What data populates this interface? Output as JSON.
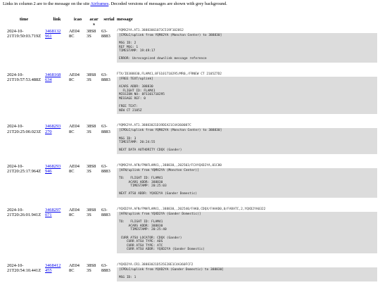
{
  "intro": {
    "before": "Links in column 2 are to the message on the site ",
    "link": "Airframes",
    "after": ". Decoded versions of messages are shown with grey background."
  },
  "columns": {
    "time": "time",
    "link": "link",
    "icao": "icao",
    "acars": "acar\ns",
    "serial": "serial",
    "message": "message"
  },
  "rows": [
    {
      "time": "2024-10-\n21T19:50:03.719Z",
      "link": "3468132\n961",
      "icao": "AE04\n8C",
      "acars": "38S8\n3S",
      "serial": "63-\n8883",
      "raw": "/YQMX2YA.AT1.38883061073C519F1020S2",
      "decoded": "[CPDLC/uplink from YQMX2YA (Moncton Center) to 388830]\n\nMSG ID: 2\nREF MSG: 1\nTIMESTAMP: 19:49:17\n\nERROR: Unrecognized downlink message reference"
    },
    {
      "time": "2024-10-\n21T19:57:53.488Z",
      "link": "3468168\n634",
      "icao": "AE04\n8C",
      "acars": "38S8\n3S",
      "serial": "63-\n8883",
      "raw": "FTX/ID388830,FLAM41,8FS101710295/MR0,/FRNEW CT 2105Z7D2",
      "decoded": "[FREE TEXT/uplink]\n\nACARS ADDR: 388830\n  FLIGHT ID: FLAM41\nMISSION NO: 8FS101710295\nMESSAGE REF: 0\n\nFREE TEXT:\nNEW CT 2105Z"
    },
    {
      "time": "2024-10-\n21T20:25:00.023Z",
      "link": "3468293\n270",
      "icao": "AE04\n8C",
      "acars": "38S8\n3S",
      "serial": "63-\n8883",
      "raw": "/YQMX2YA.AT1.38883021D19DEA21C4A360087C",
      "decoded": "[CPDLC/uplink from YQMX2YA (Moncton Center) to 388830]\n\nMSG ID: 3\nTIMESTAMP: 20:24:55\n\nNEXT DATA AUTHORITY CDQX (Gander)"
    },
    {
      "time": "2024-10-\n21T20:25:17.964Z",
      "link": "3468293\n946",
      "icao": "AE04\n8C",
      "acars": "38S8\n3S",
      "serial": "63-\n8883",
      "raw": "/YQMX2YA.AFN/FMHFLAM41,,388830,,202503/FCAYQXD2YA,01C80",
      "decoded": "[AFN/uplink from YQMX2YA (Moncton Center)]\n\nTO:   FLIGHT ID: FLAM41\n     ACARS ADDR: 388830\n      TIMESTAMP: 20:25:03\n\nNEXT ATSU ADDR: YQXD2YA (Gander Domestic)"
    },
    {
      "time": "2024-10-\n21T20:26:01.941Z",
      "link": "3468297\n071",
      "icao": "AE04\n8C",
      "acars": "38S8\n3S",
      "serial": "63-\n8883",
      "raw": "/YQXD2YA.AFN/FMHFLAM41,.388830,,202540/FAK0,CDQX/FAHAD0,0/FARATC,2,YQXD2YA0322",
      "decoded": "[AFN/uplink from YQXD2YA (Gander Domestic)]\n\nTO:   FLIGHT ID: FLAM41\n     ACARS ADDR: 388830\n      TIMESTAMP: 20:25:40\n\n CURR ATSU LOCATOR: CDQX (Gander)\n    CURR ATSU TYPE: ADS\n    CURR ATSU TYPE: ATC\n    CURR ATSU ADDR: YQXD2YA (Gander Domestic)"
    },
    {
      "time": "2024-10-\n21T20:54:10.441Z",
      "link": "3468412\n455",
      "icao": "AE04\n8C",
      "acars": "38S8\n3S",
      "serial": "63-\n8883",
      "raw": "/YQXD2YA.CR1.38883021D535E28E1C4A360FCF2",
      "decoded": "[CPDLC/uplink from YQXD2YA (Gander Domestic) to 388830]\n\nMSG ID: 1"
    }
  ]
}
